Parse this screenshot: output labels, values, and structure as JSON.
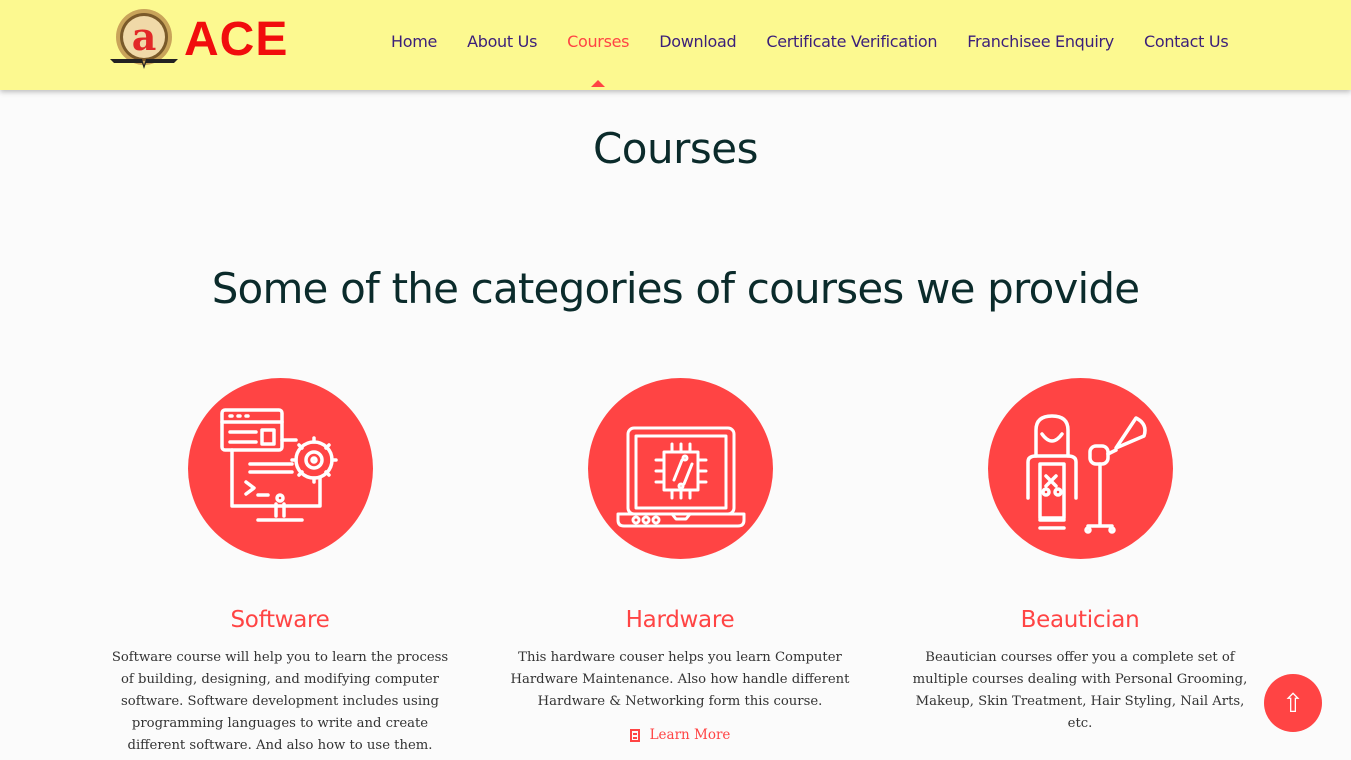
{
  "header": {
    "logo_text": "ACE",
    "logo_emblem_letter": "a",
    "nav": [
      {
        "label": "Home",
        "active": false
      },
      {
        "label": "About Us",
        "active": false
      },
      {
        "label": "Courses",
        "active": true
      },
      {
        "label": "Download",
        "active": false
      },
      {
        "label": "Certificate Verification",
        "active": false
      },
      {
        "label": "Franchisee Enquiry",
        "active": false
      },
      {
        "label": "Contact Us",
        "active": false
      }
    ]
  },
  "page_title": "Courses",
  "section_title": "Some of the categories of courses we provide",
  "courses": [
    {
      "title": "Software",
      "icon": "software-development-icon",
      "description": "Software course will help you to learn the process of building, designing, and modifying computer software. Software development includes using programming languages to write and create different software. And also how to use them."
    },
    {
      "title": "Hardware",
      "icon": "laptop-chip-icon",
      "description": "This hardware couser helps you learn Computer Hardware Maintenance. Also how handle different Hardware & Networking form this course.",
      "link_label": "Learn More"
    },
    {
      "title": "Beautician",
      "icon": "beautician-icon",
      "description": "Beautician courses offer you a complete set of multiple courses dealing with Personal Grooming, Makeup, Skin Treatment, Hair Styling, Nail Arts, etc."
    }
  ],
  "scroll_top_icon": "⇧",
  "colors": {
    "header_bg": "#fcf990",
    "accent": "#ff4444",
    "nav_text": "#3b1f7a",
    "heading": "#0b2b2b",
    "logo_red": "#f10d0d"
  }
}
